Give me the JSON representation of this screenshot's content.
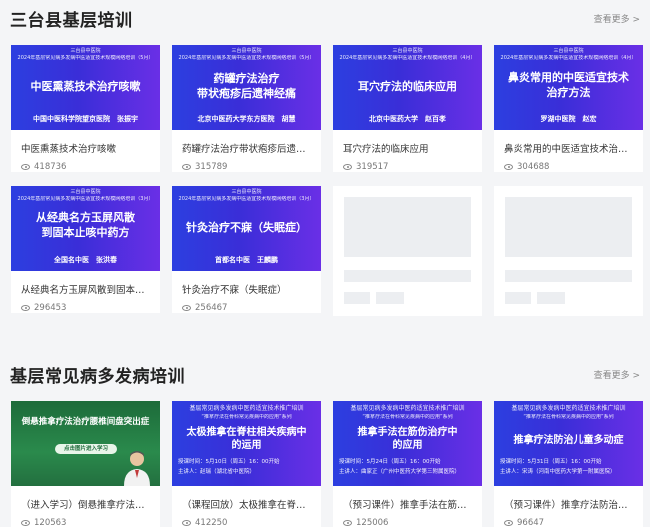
{
  "sections": [
    {
      "title": "三台县基层培训",
      "more": "查看更多 >",
      "cards": [
        {
          "org": "三台县中医院",
          "sub": "2024年基层常见病多发病中医适宜技术规模网络培训（5月）",
          "main": "中医熏蒸技术治疗咳嗽",
          "author": "中国中医科学院望京医院　张振宇",
          "title": "中医熏蒸技术治疗咳嗽",
          "views": "418736"
        },
        {
          "org": "三台县中医院",
          "sub": "2024年基层常见病多发病中医适宜技术规模网络培训（5月）",
          "main": "药罐疗法治疗\n带状疱疹后遗神经痛",
          "author": "北京中医药大学东方医院　胡慧",
          "title": "药罐疗法治疗带状疱疹后遗神经痛",
          "views": "315789"
        },
        {
          "org": "三台县中医院",
          "sub": "2024年基层常见病多发病中医适宜技术规模网络培训（4月）",
          "main": "耳穴疗法的临床应用",
          "author": "北京中医药大学　赵百孝",
          "title": "耳穴疗法的临床应用",
          "views": "319517"
        },
        {
          "org": "三台县中医院",
          "sub": "2024年基层常见病多发病中医适宜技术规模网络培训（4月）",
          "main": "鼻炎常用的中医适宜技术\n治疗方法",
          "author": "罗湖中医院　赵宏",
          "title": "鼻炎常用的中医适宜技术治疗方法",
          "views": "304688"
        },
        {
          "org": "三台县中医院",
          "sub": "2024年基层常见病多发病中医适宜技术规模网络培训（3月）",
          "main": "从经典名方玉屏风散\n到固本止咳中药方",
          "author": "全国名中医　张洪春",
          "title": "从经典名方玉屏风散到固本止咳中药方",
          "views": "296453"
        },
        {
          "org": "三台县中医院",
          "sub": "2024年基层常见病多发病中医适宜技术规模网络培训（3月）",
          "main": "针灸治疗不寐（失眠症）",
          "author": "首都名中医　王麟鹏",
          "title": "针灸治疗不寐（失眠症）",
          "views": "256467"
        }
      ]
    },
    {
      "title": "基层常见病多发病培训",
      "more": "查看更多 >",
      "cards": [
        {
          "main": "倒悬推拿疗法治疗腰椎间盘突出症",
          "button": "点击图片进入学习",
          "title": "（进入学习）倒悬推拿疗法治疗腰椎间盘突出症",
          "views": "120563"
        },
        {
          "org": "基层常见病多发病中医药适宜技术推广培训",
          "sub": "“推拿疗法在骨科常见疾病中的应用”系列",
          "main": "太极推拿在脊柱相关疾病中\n的运用",
          "line1": "授课时间：5月10日（周五）16：00开始",
          "line2": "主讲人：赵瑞（湖北省中医院）",
          "title": "（课程回放）太极推拿在脊柱相关疾病中的运用",
          "views": "412250"
        },
        {
          "org": "基层常见病多发病中医药适宜技术推广培训",
          "sub": "“推拿疗法在骨科常见疾病中的应用”系列",
          "main": "推拿手法在筋伤治疗中\n的应用",
          "line1": "授课时间：5月24日（周五）16：00开始",
          "line2": "主讲人：曲家正（广州中医药大学第三附属医院）",
          "title": "（预习课件）推拿手法在筋伤治疗中的应用",
          "views": "125006"
        },
        {
          "org": "基层常见病多发病中医药适宜技术推广培训",
          "sub": "“推拿疗法在骨科常见疾病中的应用”系列",
          "main": "推拿疗法防治儿童多动症",
          "line1": "授课时间：5月31日（周五）16：00开始",
          "line2": "主讲人：宋涛（河南中医药大学第一附属医院）",
          "title": "（预习课件）推拿疗法防治儿童多动症",
          "views": "96647"
        }
      ]
    }
  ],
  "colors": {
    "accent_blue": "#3a2ed8",
    "accent_green": "#1d6b3a"
  }
}
